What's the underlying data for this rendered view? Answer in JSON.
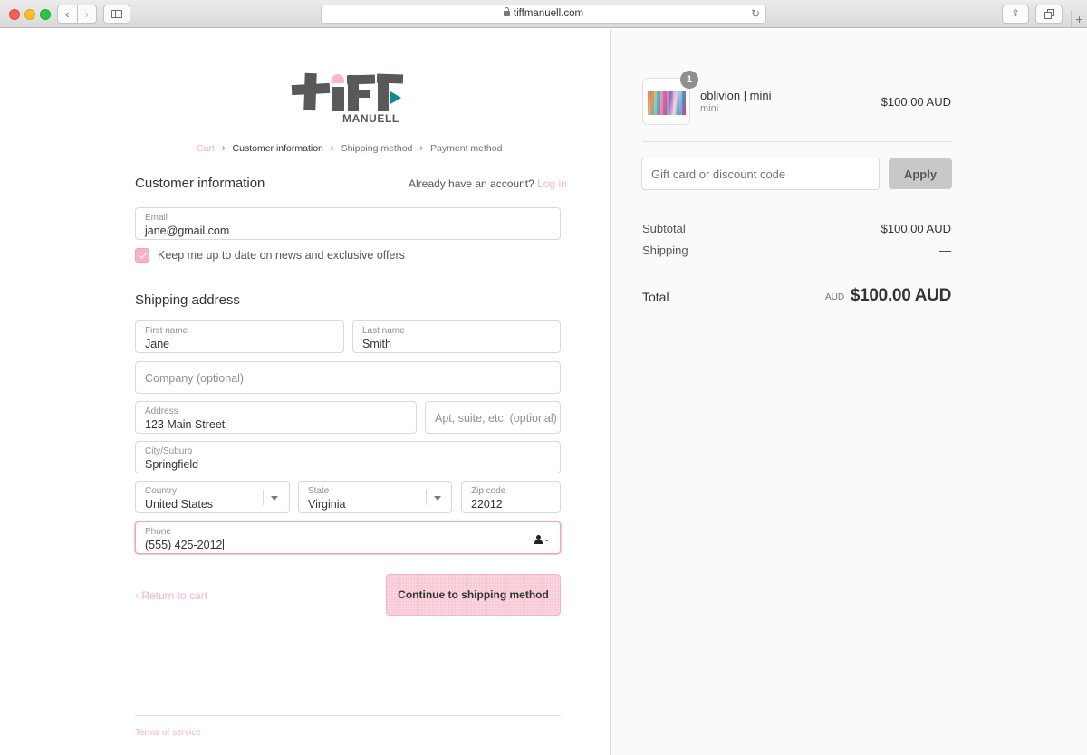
{
  "browser": {
    "url": "tiffmanuell.com",
    "icons": [
      "back-icon",
      "forward-icon",
      "sidebar-icon",
      "lock-icon",
      "reload-icon",
      "share-icon",
      "tabs-icon",
      "new-tab-icon"
    ]
  },
  "logo": {
    "wordmark": "MANUELL",
    "colors": {
      "dark": "#58595b",
      "pink": "#f6b7c6",
      "teal": "#0f8a8e"
    }
  },
  "breadcrumb": {
    "items": [
      "Cart",
      "Customer information",
      "Shipping method",
      "Payment method"
    ],
    "active_index": 1
  },
  "customer": {
    "heading": "Customer information",
    "account_prompt": "Already have an account?",
    "login_link": "Log in",
    "email": {
      "label": "Email",
      "value": "jane@gmail.com"
    },
    "newsletter": {
      "label": "Keep me up to date on news and exclusive offers",
      "checked": true
    }
  },
  "shipping": {
    "heading": "Shipping address",
    "first_name": {
      "label": "First name",
      "value": "Jane"
    },
    "last_name": {
      "label": "Last name",
      "value": "Smith"
    },
    "company": {
      "placeholder": "Company (optional)"
    },
    "address": {
      "label": "Address",
      "value": "123 Main Street"
    },
    "apartment": {
      "placeholder": "Apt, suite, etc. (optional)"
    },
    "city": {
      "label": "City/Suburb",
      "value": "Springfield"
    },
    "country": {
      "label": "Country",
      "value": "United States"
    },
    "state": {
      "label": "State",
      "value": "Virginia"
    },
    "zip": {
      "label": "Zip code",
      "value": "22012"
    },
    "phone": {
      "label": "Phone",
      "value": "(555) 425-2012"
    }
  },
  "actions": {
    "return_link": "‹ Return to cart",
    "continue_button": "Continue to shipping method"
  },
  "footer": {
    "terms": "Terms of service"
  },
  "summary": {
    "product": {
      "quantity": "1",
      "name": "oblivion | mini",
      "variant": "mini",
      "price": "$100.00 AUD"
    },
    "gift_placeholder": "Gift card or discount code",
    "apply_label": "Apply",
    "subtotal_label": "Subtotal",
    "subtotal_value": "$100.00 AUD",
    "shipping_label": "Shipping",
    "shipping_value": "—",
    "total_label": "Total",
    "total_currency": "AUD",
    "total_value": "$100.00 AUD"
  },
  "colors": {
    "accent": "#f7b3c4",
    "button": "#f8c9d4",
    "panel": "#fafafa"
  }
}
